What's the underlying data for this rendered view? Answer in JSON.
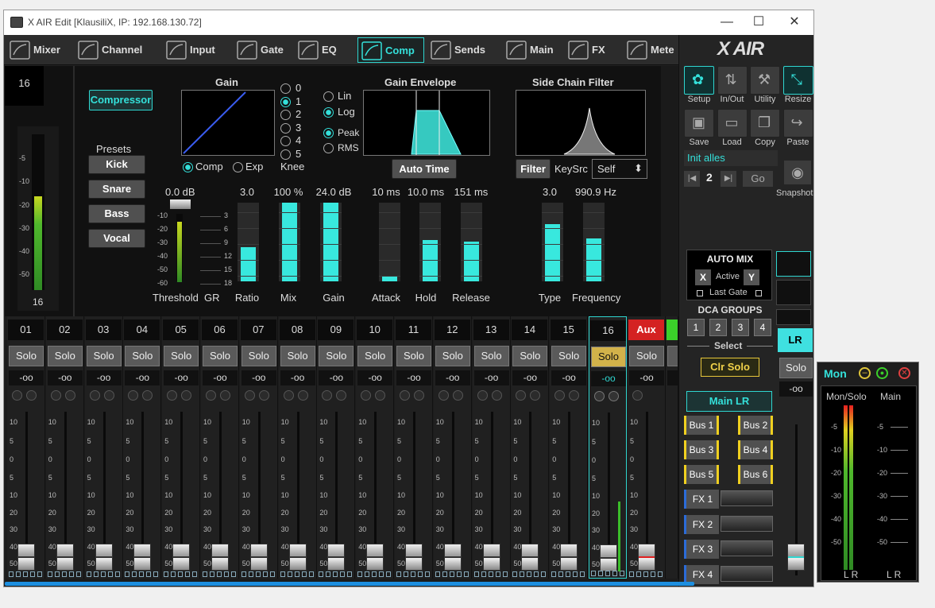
{
  "window": {
    "title": "X AIR Edit [KlausiliX, IP: 192.168.130.72]"
  },
  "tabs": [
    {
      "label": "Mixer",
      "icon": "mixer-icon"
    },
    {
      "label": "Channel",
      "icon": "channel-icon"
    },
    {
      "label": "Input",
      "icon": "input-icon"
    },
    {
      "label": "Gate",
      "icon": "gate-icon"
    },
    {
      "label": "EQ",
      "icon": "eq-icon"
    },
    {
      "label": "Comp",
      "icon": "comp-icon"
    },
    {
      "label": "Sends",
      "icon": "sends-icon"
    },
    {
      "label": "Main",
      "icon": "main-icon"
    },
    {
      "label": "FX",
      "icon": "fx-icon"
    },
    {
      "label": "Mete",
      "icon": "meter-icon"
    }
  ],
  "active_tab": "Comp",
  "comp": {
    "channel_display": "16",
    "meter_scale": [
      "-5",
      "-10",
      "-20",
      "-30",
      "-40",
      "-50"
    ],
    "meter_level": 0.6,
    "meter_bottom_label": "16",
    "compressor_button": "Compressor",
    "presets_label": "Presets",
    "presets": [
      "Kick",
      "Snare",
      "Bass",
      "Vocal"
    ],
    "gain_title": "Gain",
    "comp_radio": "Comp",
    "exp_radio": "Exp",
    "knee_options": [
      "0",
      "1",
      "2",
      "3",
      "4",
      "5"
    ],
    "knee_selected": "1",
    "knee_label": "Knee",
    "lin_label": "Lin",
    "log_label": "Log",
    "log_selected": true,
    "peak_label": "Peak",
    "rms_label": "RMS",
    "peak_selected": true,
    "envelope_title": "Gain Envelope",
    "auto_time": "Auto Time",
    "sidechain_title": "Side Chain Filter",
    "filter_button": "Filter",
    "keysrc_label": "KeySrc",
    "keysrc_value": "Self",
    "threshold_scale": [
      "-10",
      "-20",
      "-30",
      "-40",
      "-50",
      "-60"
    ],
    "gr_scale": [
      "3",
      "6",
      "9",
      "12",
      "15",
      "18"
    ],
    "threshold_value": "0.0 dB",
    "threshold_label": "Threshold",
    "gr_label": "GR",
    "params": [
      {
        "label": "Ratio",
        "value": "3.0",
        "level": 0.43
      },
      {
        "label": "Mix",
        "value": "100 %",
        "level": 1.0
      },
      {
        "label": "Gain",
        "value": "24.0 dB",
        "level": 1.0
      },
      {
        "label": "Attack",
        "value": "10 ms",
        "level": 0.07
      },
      {
        "label": "Hold",
        "value": "10.0 ms",
        "level": 0.53
      },
      {
        "label": "Release",
        "value": "151 ms",
        "level": 0.5
      },
      {
        "label": "Type",
        "value": "3.0",
        "level": 0.73
      },
      {
        "label": "Frequency",
        "value": "990.9 Hz",
        "level": 0.55
      }
    ]
  },
  "channels": {
    "numbers": [
      "01",
      "02",
      "03",
      "04",
      "05",
      "06",
      "07",
      "08",
      "09",
      "10",
      "11",
      "12",
      "13",
      "14",
      "15",
      "16"
    ],
    "aux_label": "Aux",
    "fx_label": "F",
    "lr_label": "LR",
    "solo_label": "Solo",
    "solo_partial": "S",
    "level_text": "-oo",
    "selected": "16",
    "fader_scale": [
      "10",
      "5",
      "0",
      "5",
      "10",
      "20",
      "30",
      "40",
      "50"
    ]
  },
  "right_panel": {
    "setup": "Setup",
    "inout": "In/Out",
    "utility": "Utility",
    "resize": "Resize",
    "save": "Save",
    "load": "Load",
    "copy": "Copy",
    "paste": "Paste",
    "scene_name": "Init alles",
    "scene_number": "2",
    "go": "Go",
    "snapshot": "Snapshot",
    "automix_title": "AUTO MIX",
    "automix_x": "X",
    "automix_active": "Active",
    "automix_y": "Y",
    "last_gate": "Last Gate",
    "dca_title": "DCA GROUPS",
    "dca": [
      "1",
      "2",
      "3",
      "4"
    ],
    "select_label": "Select",
    "clr_solo": "Clr Solo",
    "main_lr": "Main LR",
    "buses": [
      "Bus 1",
      "Bus 2",
      "Bus 3",
      "Bus 4",
      "Bus 5",
      "Bus 6"
    ],
    "fx": [
      "FX 1",
      "FX 2",
      "FX 3",
      "FX 4"
    ]
  },
  "monitor": {
    "title": "Mon",
    "col1": "Mon/Solo",
    "col2": "Main",
    "scale": [
      "-5",
      "-10",
      "-20",
      "-30",
      "-40",
      "-50"
    ],
    "lr1": "L R",
    "lr2": "L R"
  }
}
